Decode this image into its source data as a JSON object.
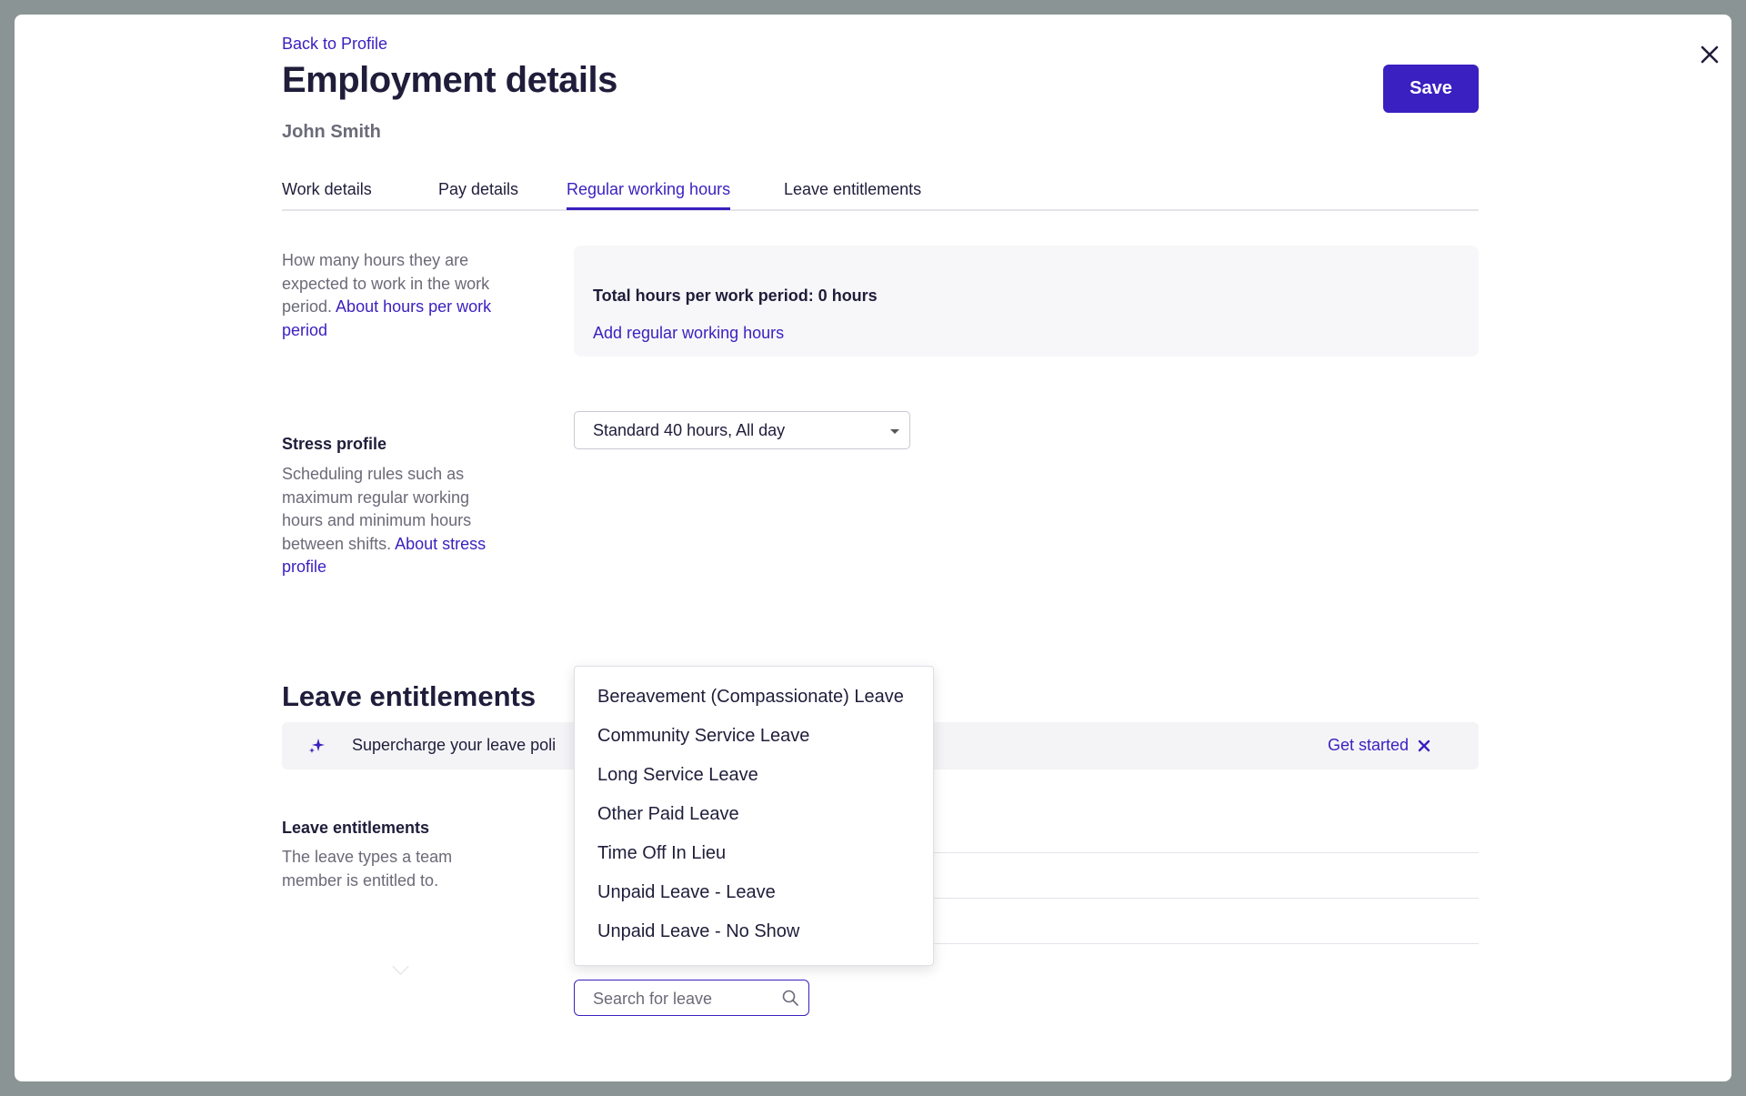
{
  "page": {
    "back_link": "Back to Profile",
    "title": "Employment details",
    "subtitle": "John Smith",
    "save_label": "Save"
  },
  "tabs": [
    {
      "label": "Work details",
      "active": false
    },
    {
      "label": "Pay details",
      "active": false
    },
    {
      "label": "Regular working hours",
      "active": true
    },
    {
      "label": "Leave entitlements",
      "active": false
    }
  ],
  "hours_section": {
    "help_prefix": "How many hours they are expected to work in the work period. ",
    "help_link": "About hours per work period",
    "total_label": "Total hours per work period: 0 hours",
    "add_link": "Add regular working hours"
  },
  "stress_section": {
    "label": "Stress profile",
    "help_prefix": "Scheduling rules such as maximum regular working hours and minimum hours between shifts. ",
    "help_link": "About stress profile",
    "selected_value": "Standard 40 hours, All day"
  },
  "leave_section": {
    "heading": "Leave entitlements",
    "banner_text": "Supercharge your leave poli",
    "banner_link": "Get started",
    "field_label": "Leave entitlements",
    "field_help": "The leave types a team member is entitled to.",
    "search_placeholder": "Search for leave",
    "dropdown_options": [
      "Bereavement (Compassionate) Leave",
      "Community Service Leave",
      "Long Service Leave",
      "Other Paid Leave",
      "Time Off In Lieu",
      "Unpaid Leave - Leave",
      "Unpaid Leave - No Show"
    ]
  },
  "icons": {
    "close": "close-icon",
    "sparkle": "sparkle-icon",
    "dismiss": "dismiss-icon",
    "caret": "chevron-down-icon",
    "search": "search-icon"
  },
  "colors": {
    "accent": "#3b1fbf",
    "text": "#1f1d3a",
    "muted": "#6b6a78"
  }
}
